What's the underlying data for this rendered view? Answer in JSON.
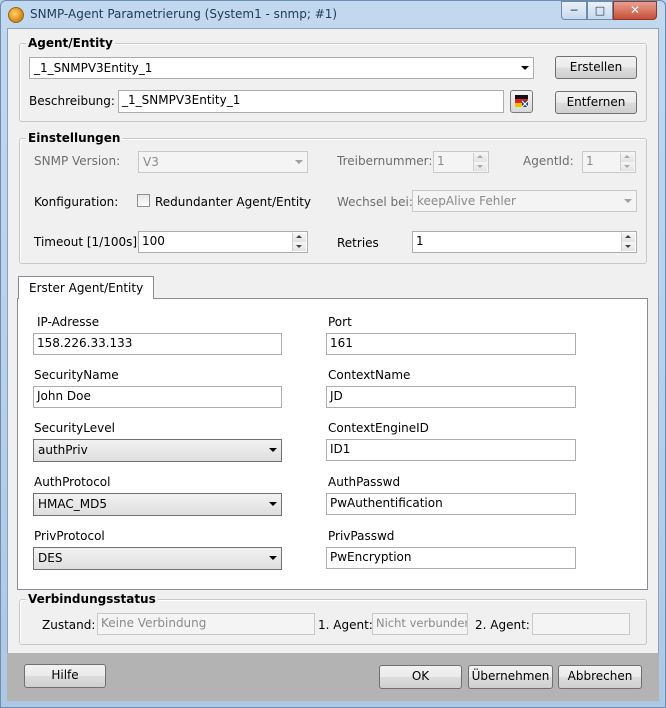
{
  "window": {
    "title": "SNMP-Agent Parametrierung (System1 - snmp; #1)",
    "minimize": "─",
    "maximize": "□",
    "close": "✕"
  },
  "agent_entity": {
    "legend": "Agent/Entity",
    "selected": "_1_SNMPV3Entity_1",
    "create_button": "Erstellen",
    "description_label": "Beschreibung:",
    "description_value": "_1_SNMPV3Entity_1",
    "remove_button": "Entfernen"
  },
  "settings": {
    "legend": "Einstellungen",
    "snmp_version_label": "SNMP Version:",
    "snmp_version_value": "V3",
    "driver_number_label": "Treibernummer:",
    "driver_number_value": "1",
    "agent_id_label": "AgentId:",
    "agent_id_value": "1",
    "config_label": "Konfiguration:",
    "redundant_label": "Redundanter Agent/Entity",
    "switch_label": "Wechsel bei:",
    "switch_value": "keepAlive Fehler",
    "timeout_label": "Timeout [1/100s]",
    "timeout_value": "100",
    "retries_label": "Retries",
    "retries_value": "1"
  },
  "tab": {
    "label": "Erster Agent/Entity",
    "ip_label": "IP-Adresse",
    "ip_value": "158.226.33.133",
    "port_label": "Port",
    "port_value": "161",
    "security_name_label": "SecurityName",
    "security_name_value": "John Doe",
    "context_name_label": "ContextName",
    "context_name_value": "JD",
    "security_level_label": "SecurityLevel",
    "security_level_value": "authPriv",
    "context_engine_label": "ContextEngineID",
    "context_engine_value": "ID1",
    "auth_protocol_label": "AuthProtocol",
    "auth_protocol_value": "HMAC_MD5",
    "auth_passwd_label": "AuthPasswd",
    "auth_passwd_value": "PwAuthentification",
    "priv_protocol_label": "PrivProtocol",
    "priv_protocol_value": "DES",
    "priv_passwd_label": "PrivPasswd",
    "priv_passwd_value": "PwEncryption"
  },
  "status": {
    "legend": "Verbindungsstatus",
    "state_label": "Zustand:",
    "state_value": "Keine Verbindung",
    "agent1_label": "1. Agent:",
    "agent1_value": "Nicht verbunden",
    "agent2_label": "2. Agent:",
    "agent2_value": ""
  },
  "footer": {
    "help": "Hilfe",
    "ok": "OK",
    "apply": "Übernehmen",
    "cancel": "Abbrechen"
  }
}
